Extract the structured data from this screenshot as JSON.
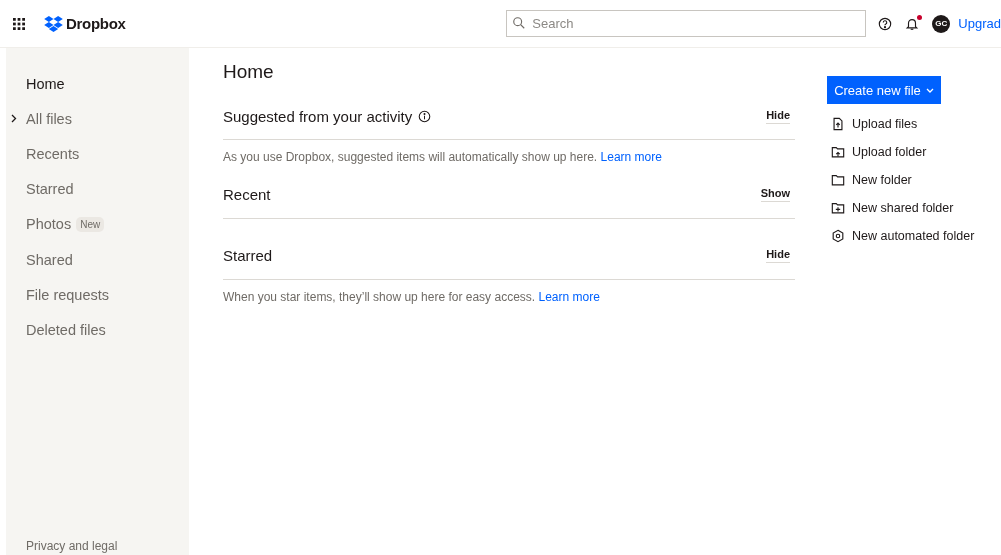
{
  "header": {
    "logo": "Dropbox",
    "search": {
      "placeholder": "Search"
    },
    "notification_unread": true,
    "avatar": "GC",
    "upgrade": "Upgrad"
  },
  "sidebar": {
    "items": [
      {
        "label": "Home",
        "selected": true
      },
      {
        "label": "All files",
        "selected": false,
        "expanded": false
      },
      {
        "label": "Recents",
        "selected": false
      },
      {
        "label": "Starred",
        "selected": false
      },
      {
        "label": "Photos",
        "selected": false,
        "badge": "New"
      },
      {
        "label": "Shared",
        "selected": false
      },
      {
        "label": "File requests",
        "selected": false
      },
      {
        "label": "Deleted files",
        "selected": false
      }
    ],
    "footer": "Privacy and legal"
  },
  "main": {
    "title": "Home",
    "sections": [
      {
        "title": "Suggested from your activity",
        "info": true,
        "toggle": "Hide",
        "text": "As you use Dropbox, suggested items will automatically show up here.",
        "link": "Learn more"
      },
      {
        "title": "Recent",
        "info": false,
        "toggle": "Show"
      },
      {
        "title": "Starred",
        "info": false,
        "toggle": "Hide",
        "text": "When you star items, they’ll show up here for easy access.",
        "link": "Learn more"
      }
    ]
  },
  "actions": {
    "create_button": "Create new file",
    "items": [
      {
        "kind": "upload-file",
        "label": "Upload files"
      },
      {
        "kind": "upload-folder",
        "label": "Upload folder"
      },
      {
        "kind": "folder",
        "label": "New folder"
      },
      {
        "kind": "shared-folder",
        "label": "New shared folder"
      },
      {
        "kind": "automated-folder",
        "label": "New automated folder"
      }
    ]
  }
}
